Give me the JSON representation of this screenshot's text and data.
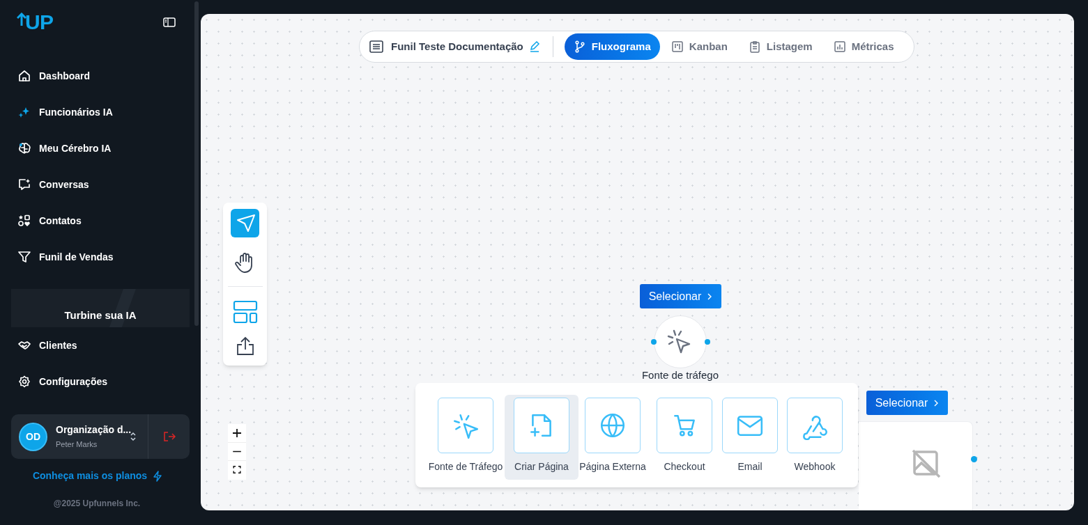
{
  "sidebar": {
    "logo": "UP",
    "nav": [
      {
        "label": "Dashboard"
      },
      {
        "label": "Funcionários IA"
      },
      {
        "label": "Meu Cérebro IA"
      },
      {
        "label": "Conversas"
      },
      {
        "label": "Contatos"
      },
      {
        "label": "Funil de Vendas"
      }
    ],
    "promo": {
      "title": "Turbine sua IA"
    },
    "nav_bottom": [
      {
        "label": "Clientes"
      },
      {
        "label": "Configurações"
      }
    ],
    "organization": {
      "initials": "OD",
      "name": "Organização d...",
      "user": "Peter Marks"
    },
    "plans_link": "Conheça mais os planos",
    "footer": "@2025 Upfunnels Inc."
  },
  "toolbar": {
    "funnel_name": "Funil Teste Documentação",
    "tabs": [
      {
        "label": "Fluxograma",
        "selected": true
      },
      {
        "label": "Kanban",
        "selected": false
      },
      {
        "label": "Listagem",
        "selected": false
      },
      {
        "label": "Métricas",
        "selected": false
      }
    ]
  },
  "tools": [
    {
      "kind": "select",
      "selected": true
    },
    {
      "kind": "hand",
      "selected": false
    }
  ],
  "nodes": [
    {
      "button": "Selecionar",
      "label": "Fonte de tráfego"
    },
    {
      "button": "Selecionar"
    }
  ],
  "palette": [
    {
      "label": "Fonte de Tráfego",
      "selected": false
    },
    {
      "label": "Criar Página",
      "selected": true
    },
    {
      "label": "Página Externa",
      "selected": false
    },
    {
      "label": "Checkout",
      "selected": false
    },
    {
      "label": "Email",
      "selected": false
    },
    {
      "label": "Webhook",
      "selected": false
    }
  ]
}
